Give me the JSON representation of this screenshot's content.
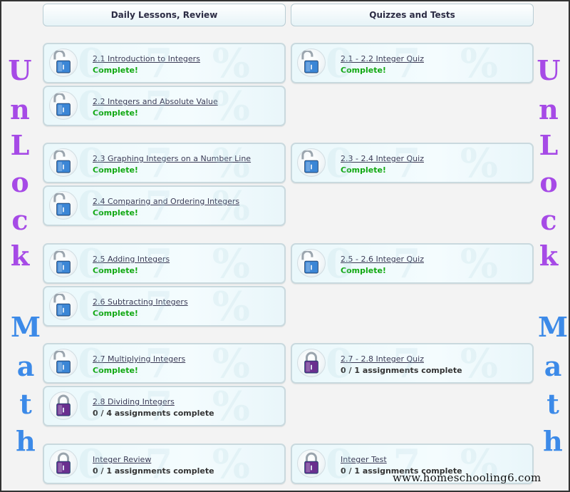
{
  "headers": {
    "lessons": "Daily Lessons, Review",
    "quizzes": "Quizzes and Tests"
  },
  "side_text": {
    "unlock": [
      "U",
      "n",
      "L",
      "o",
      "c",
      "k"
    ],
    "math": [
      "M",
      "a",
      "t",
      "h"
    ]
  },
  "colors": {
    "unlock_letters": "#a64ae6",
    "math_letters": "#3c8ae8",
    "complete": "#11a811",
    "lock_unlocked": "#3b86d6",
    "lock_locked": "#6a2f8f"
  },
  "lessons": [
    {
      "title": "2.1 Introduction to Integers",
      "status": "Complete!",
      "state": "complete",
      "icon": "unlocked-padlock"
    },
    {
      "title": "2.2 Integers and Absolute Value",
      "status": "Complete!",
      "state": "complete",
      "icon": "unlocked-padlock"
    },
    {
      "title": "2.3 Graphing Integers on a Number Line",
      "status": "Complete!",
      "state": "complete",
      "icon": "unlocked-padlock"
    },
    {
      "title": "2.4 Comparing and Ordering Integers",
      "status": "Complete!",
      "state": "complete",
      "icon": "unlocked-padlock"
    },
    {
      "title": "2.5 Adding Integers",
      "status": "Complete!",
      "state": "complete",
      "icon": "unlocked-padlock"
    },
    {
      "title": "2.6 Subtracting Integers",
      "status": "Complete!",
      "state": "complete",
      "icon": "unlocked-padlock"
    },
    {
      "title": "2.7 Multiplying Integers",
      "status": "Complete!",
      "state": "complete",
      "icon": "unlocked-padlock"
    },
    {
      "title": "2.8 Dividing Integers",
      "status": "0 / 4 assignments complete",
      "state": "pending",
      "icon": "locked-padlock"
    },
    {
      "title": "Integer Review",
      "status": "0 / 1 assignments complete",
      "state": "pending",
      "icon": "locked-padlock"
    }
  ],
  "quizzes": [
    {
      "title": "2.1 - 2.2 Integer Quiz",
      "status": "Complete!",
      "state": "complete",
      "icon": "unlocked-padlock"
    },
    {
      "title": "2.3 - 2.4 Integer Quiz",
      "status": "Complete!",
      "state": "complete",
      "icon": "unlocked-padlock"
    },
    {
      "title": "2.5 - 2.6 Integer Quiz",
      "status": "Complete!",
      "state": "complete",
      "icon": "unlocked-padlock"
    },
    {
      "title": "2.7 - 2.8 Integer Quiz",
      "status": "0 / 1 assignments complete",
      "state": "pending",
      "icon": "locked-padlock"
    },
    {
      "title": "Integer Test",
      "status": "0 / 1 assignments complete",
      "state": "pending",
      "icon": "locked-padlock"
    }
  ],
  "watermark": "www.homeschooling6.com"
}
